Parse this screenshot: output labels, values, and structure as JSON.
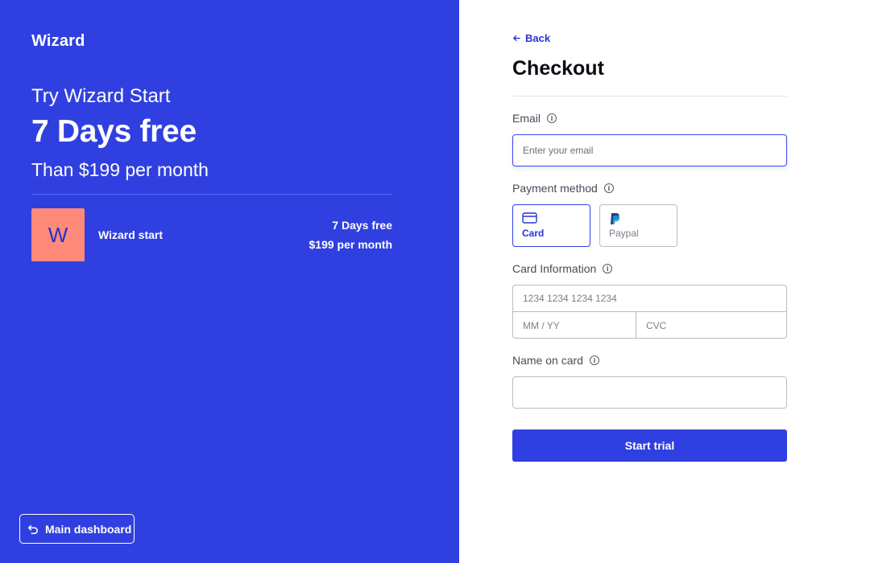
{
  "left_panel": {
    "brand": "Wizard",
    "headline": "Try Wizard Start",
    "offer": "7 Days free",
    "price_line": "Than $199 per month",
    "plan": {
      "logo_letter": "W",
      "name": "Wizard start",
      "trial": "7 Days free",
      "price": "$199 per month"
    },
    "dashboard_button": "Main dashboard"
  },
  "checkout": {
    "back_label": "Back",
    "title": "Checkout",
    "email": {
      "label": "Email",
      "placeholder": "Enter your email",
      "value": ""
    },
    "payment_method": {
      "label": "Payment method",
      "options": [
        {
          "label": "Card",
          "icon": "credit-card-icon",
          "selected": true
        },
        {
          "label": "Paypal",
          "icon": "paypal-icon",
          "selected": false
        }
      ]
    },
    "card_info": {
      "label": "Card Information",
      "number_placeholder": "1234 1234 1234 1234",
      "expiry_placeholder": "MM / YY",
      "cvc_placeholder": "CVC"
    },
    "name_on_card": {
      "label": "Name on card",
      "value": ""
    },
    "submit_label": "Start trial"
  },
  "colors": {
    "accent": "#3040e0",
    "plan_logo_bg": "#ff8a7a",
    "text_dark": "#0b0b14"
  }
}
